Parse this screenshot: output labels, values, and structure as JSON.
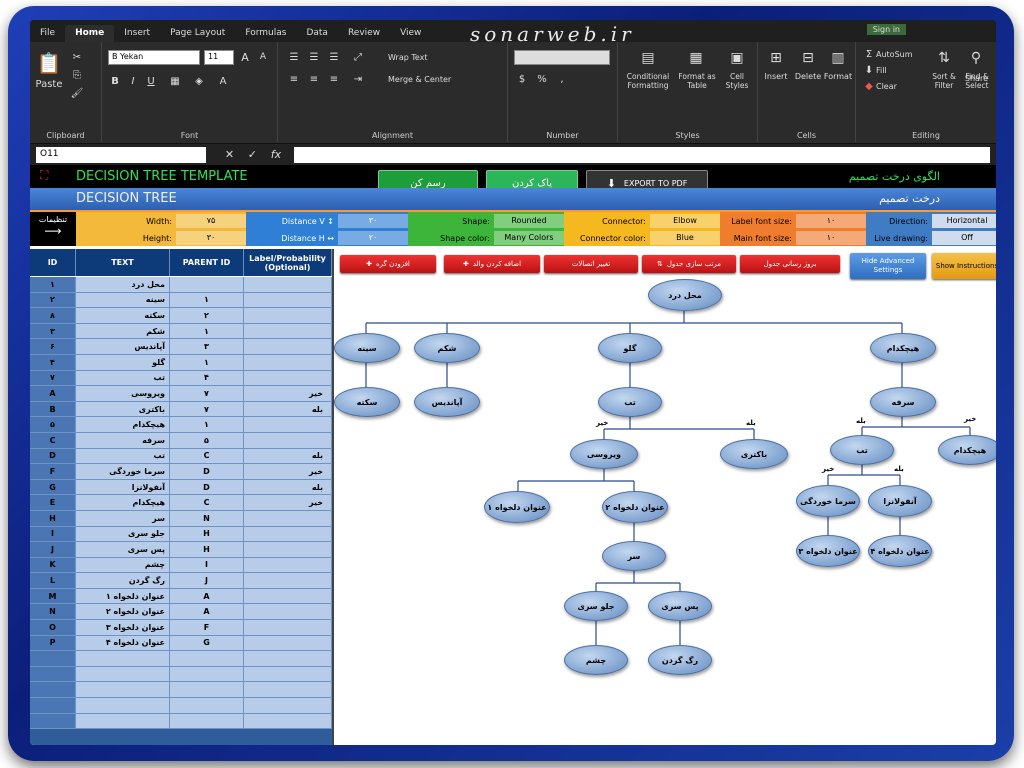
{
  "ribbon": {
    "tabs": [
      "File",
      "Home",
      "Insert",
      "Page Layout",
      "Formulas",
      "Data",
      "Review",
      "View"
    ],
    "watermark": "sonarweb.ir",
    "signin": "Sign in",
    "share": "Share",
    "paste": "Paste",
    "clipboard": "Clipboard",
    "font_name": "B Yekan",
    "font_size": "11",
    "font_group": "Font",
    "wrap_text": "Wrap Text",
    "merge_center": "Merge & Center",
    "alignment": "Alignment",
    "number": "Number",
    "conditional": "Conditional Formatting",
    "format_table": "Format as Table",
    "cell_styles": "Cell Styles",
    "styles": "Styles",
    "insert": "Insert",
    "delete": "Delete",
    "format": "Format",
    "cells": "Cells",
    "autosum": "AutoSum",
    "fill": "Fill",
    "clear": "Clear",
    "sort_filter": "Sort & Filter",
    "find_select": "Find & Select",
    "editing": "Editing"
  },
  "formula_bar": {
    "name_box": "O11",
    "fx": "fx",
    "formula": ""
  },
  "header": {
    "title_en": "DECISION TREE TEMPLATE",
    "subtitle_en": "DECISION TREE",
    "title_fa": "الگوی درخت تصمیم",
    "subtitle_fa": "درخت تصمیم",
    "draw_button": "رسم کن",
    "clear_button": "پاک کردن",
    "export_button": "EXPORT TO PDF"
  },
  "settings": {
    "label": "تنظیمات",
    "width_label": "Width:",
    "width_value": "۷۵",
    "height_label": "Height:",
    "height_value": "۳۰",
    "distance_v_label": "Distance V ↕",
    "distance_v_value": "۳۰",
    "distance_h_label": "Distance H ↔",
    "distance_h_value": "۲۰",
    "shape_label": "Shape:",
    "shape_value": "Rounded",
    "shape_color_label": "Shape color:",
    "shape_color_value": "Many Colors",
    "connector_label": "Connector:",
    "connector_value": "Elbow",
    "connector_color_label": "Connector color:",
    "connector_color_value": "Blue",
    "label_font_label": "Label font size:",
    "label_font_value": "۱۰",
    "main_font_label": "Main font size:",
    "main_font_value": "۱۰",
    "direction_label": "Direction:",
    "direction_value": "Horizontal",
    "live_label": "Live drawing:",
    "live_value": "Off"
  },
  "table": {
    "headers": [
      "ID",
      "TEXT",
      "PARENT ID",
      "Label/Probability (Optional)"
    ],
    "rows": [
      [
        "۱",
        "محل درد",
        "",
        ""
      ],
      [
        "۲",
        "سینه",
        "۱",
        ""
      ],
      [
        "۸",
        "سکته",
        "۲",
        ""
      ],
      [
        "۳",
        "شکم",
        "۱",
        ""
      ],
      [
        "۶",
        "آپاندیس",
        "۳",
        ""
      ],
      [
        "۴",
        "گلو",
        "۱",
        ""
      ],
      [
        "۷",
        "تب",
        "۴",
        ""
      ],
      [
        "A",
        "ویروسی",
        "۷",
        "خیر"
      ],
      [
        "B",
        "باکتری",
        "۷",
        "بله"
      ],
      [
        "۵",
        "هیچکدام",
        "۱",
        ""
      ],
      [
        "C",
        "سرفه",
        "۵",
        ""
      ],
      [
        "D",
        "تب",
        "C",
        "بله"
      ],
      [
        "F",
        "سرما خوردگی",
        "D",
        "خیر"
      ],
      [
        "G",
        "آنفولانزا",
        "D",
        "بله"
      ],
      [
        "E",
        "هیچکدام",
        "C",
        "خیر"
      ],
      [
        "H",
        "سر",
        "N",
        ""
      ],
      [
        "I",
        "جلو سری",
        "H",
        ""
      ],
      [
        "J",
        "پس سری",
        "H",
        ""
      ],
      [
        "K",
        "چشم",
        "I",
        ""
      ],
      [
        "L",
        "رگ گردن",
        "J",
        ""
      ],
      [
        "M",
        "عنوان دلخواه ۱",
        "A",
        ""
      ],
      [
        "N",
        "عنوان دلخواه ۲",
        "A",
        ""
      ],
      [
        "O",
        "عنوان دلخواه ۳",
        "F",
        ""
      ],
      [
        "P",
        "عنوان دلخواه ۴",
        "G",
        ""
      ],
      [
        "",
        "",
        "",
        ""
      ],
      [
        "",
        "",
        "",
        ""
      ],
      [
        "",
        "",
        "",
        ""
      ],
      [
        "",
        "",
        "",
        ""
      ],
      [
        "",
        "",
        "",
        ""
      ]
    ]
  },
  "actions": {
    "add_node": "افزودن گره",
    "add_parent": "اضافه کردن والد",
    "change_connections": "تغییر اتصالات",
    "sort_table": "مرتب سازی جدول",
    "update_table": "بروز رسانی جدول",
    "hide_advanced": "Hide Advanced Settings",
    "show_instructions": "Show Instructions"
  },
  "tree": {
    "root": "محل درد",
    "n_chest": "سینه",
    "n_abdomen": "شکم",
    "n_throat": "گلو",
    "n_none": "هیچکدام",
    "n_stroke": "سکته",
    "n_appendix": "آپاندیس",
    "n_fever": "تب",
    "n_cough": "سرفه",
    "n_viral": "ویروسی",
    "n_bacterial": "باکتری",
    "n_fever2": "تب",
    "n_none2": "هیچکدام",
    "n_custom1": "عنوان دلخواه ۱",
    "n_custom2": "عنوان دلخواه ۲",
    "n_cold": "سرما خوردگی",
    "n_flu": "آنفولانزا",
    "n_custom3": "عنوان دلخواه ۳",
    "n_custom4": "عنوان دلخواه ۴",
    "n_head": "سر",
    "n_front": "جلو سری",
    "n_back": "پس سری",
    "n_eye": "چشم",
    "n_neck": "رگ گردن",
    "yes": "بله",
    "no": "خیر"
  }
}
